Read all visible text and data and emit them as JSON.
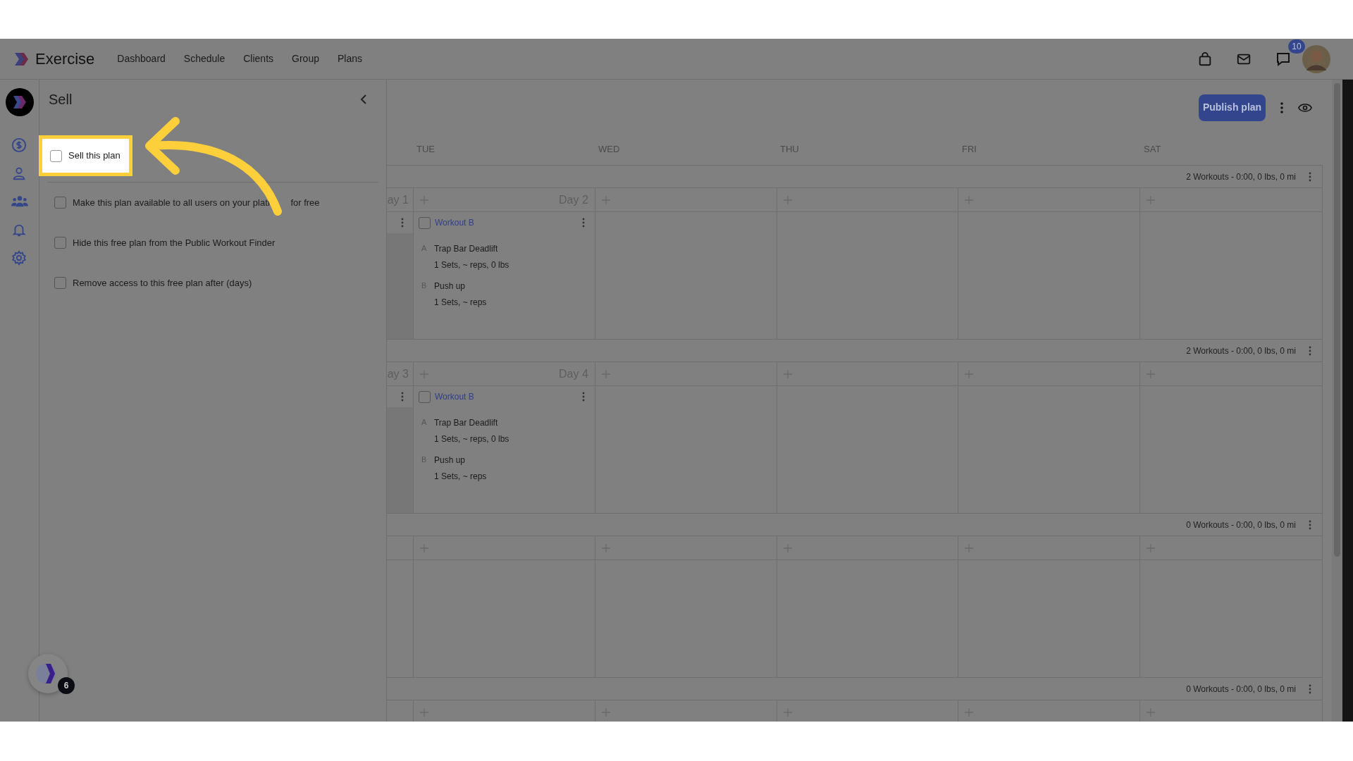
{
  "nav": {
    "brand": "Exercise",
    "links": [
      "Dashboard",
      "Schedule",
      "Clients",
      "Group",
      "Plans"
    ],
    "chat_badge": "10"
  },
  "sell_panel": {
    "title": "Sell",
    "options": [
      {
        "label": "Sell this plan",
        "checked": false,
        "highlighted": true
      },
      {
        "label": "Make this plan available to all users on your platf",
        "label_after_arrow": "for free",
        "checked": false,
        "highlighted": false
      },
      {
        "label": "Hide this free plan from the Public Workout Finder",
        "checked": false,
        "highlighted": false
      },
      {
        "label": "Remove access to this free plan after (days)",
        "checked": false,
        "highlighted": false
      }
    ]
  },
  "toolbar": {
    "publish": "Publish plan"
  },
  "day_headers": [
    "TUE",
    "WED",
    "THU",
    "FRI",
    "SAT"
  ],
  "weeks": [
    {
      "summary": "2 Workouts - 0:00, 0 lbs, 0 mi",
      "cut_day_label": "ay 1",
      "cut_workout": true,
      "days": [
        {
          "label": "Day 2",
          "workouts": [
            {
              "title": "Workout B",
              "checked": false,
              "exercises": [
                {
                  "letter": "A",
                  "name": "Trap Bar Deadlift",
                  "detail": "1 Sets, ~ reps, 0 lbs"
                },
                {
                  "letter": "B",
                  "name": "Push up",
                  "detail": "1 Sets, ~ reps"
                }
              ]
            }
          ]
        }
      ]
    },
    {
      "summary": "2 Workouts - 0:00, 0 lbs, 0 mi",
      "cut_day_label": "ay 3",
      "cut_workout": true,
      "days": [
        {
          "label": "Day 4",
          "workouts": [
            {
              "title": "Workout B",
              "checked": false,
              "exercises": [
                {
                  "letter": "A",
                  "name": "Trap Bar Deadlift",
                  "detail": "1 Sets, ~ reps, 0 lbs"
                },
                {
                  "letter": "B",
                  "name": "Push up",
                  "detail": "1 Sets, ~ reps"
                }
              ]
            }
          ]
        }
      ]
    },
    {
      "summary": "0 Workouts - 0:00, 0 lbs, 0 mi",
      "cut_workout": false
    },
    {
      "summary": "0 Workouts - 0:00, 0 lbs, 0 mi",
      "cut_workout": false
    }
  ],
  "widget_badge": "6"
}
